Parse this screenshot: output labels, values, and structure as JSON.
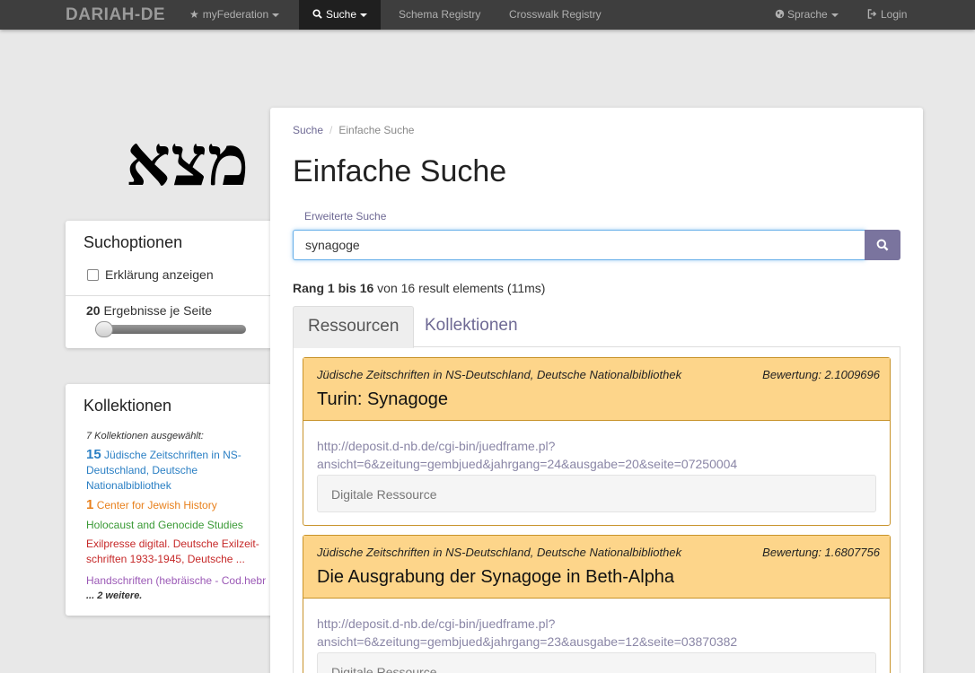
{
  "navbar": {
    "brand": "DARIAH-DE",
    "items": [
      {
        "label": "myFederation"
      },
      {
        "label": "Suche"
      },
      {
        "label": "Schema Registry"
      },
      {
        "label": "Crosswalk Registry"
      }
    ],
    "language": "Sprache",
    "login": "Login"
  },
  "logo": {
    "text": "מצא"
  },
  "options": {
    "title": "Suchoptionen",
    "checkbox_label": "Erklärung anzeigen",
    "per_page_count": "20",
    "per_page_label": "Ergebnisse je Seite",
    "slider_value": 20
  },
  "collections": {
    "title": "Kollektionen",
    "selected": "7 Kollektionen ausgewählt:",
    "items": [
      {
        "count": "15",
        "name": "Jüdische Zeitschriften in NS-Deutschland, Deutsche Nationalbibliothek",
        "color": "#2a7fc4"
      },
      {
        "count": "1",
        "name": "Center for Jewish History",
        "color": "#e8801c"
      },
      {
        "count": "",
        "name": "Holocaust and Genocide Studies",
        "color": "#3a9a36"
      },
      {
        "count": "",
        "name": "Exilpresse digital. Deutsche Exilzeit-schriften 1933-1945, Deutsche ...",
        "color": "#c62828"
      },
      {
        "count": "",
        "name": "Handschriften (hebräische - Cod.hebr",
        "color": "#9b59b6"
      }
    ],
    "more": "... 2 weitere."
  },
  "breadcrumb": {
    "root": "Suche",
    "current": "Einfache Suche"
  },
  "page_title": "Einfache Suche",
  "search": {
    "advanced_link": "Erweiterte Suche",
    "query": "synagoge"
  },
  "result_info": {
    "range_label": "Rang",
    "from": "1",
    "to_label": "bis",
    "to": "16",
    "rest": "von 16 result elements (11ms)"
  },
  "tabs": [
    "Ressourcen",
    "Kollektionen"
  ],
  "results": [
    {
      "collection": "Jüdische Zeitschriften in NS-Deutschland, Deutsche Nationalbibliothek",
      "score": "Bewertung: 2.1009696",
      "title": "Turin: Synagoge",
      "url": "http://deposit.d-nb.de/cgi-bin/juedframe.pl?ansicht=6&zeitung=gembjued&jahrgang=24&ausgabe=20&seite=07250004",
      "type": "Digitale Ressource"
    },
    {
      "collection": "Jüdische Zeitschriften in NS-Deutschland, Deutsche Nationalbibliothek",
      "score": "Bewertung: 1.6807756",
      "title": "Die Ausgrabung der Synagoge in Beth-Alpha",
      "url": "http://deposit.d-nb.de/cgi-bin/juedframe.pl?ansicht=6&zeitung=gembjued&jahrgang=23&ausgabe=12&seite=03870382",
      "type": "Digitale Ressource"
    }
  ]
}
